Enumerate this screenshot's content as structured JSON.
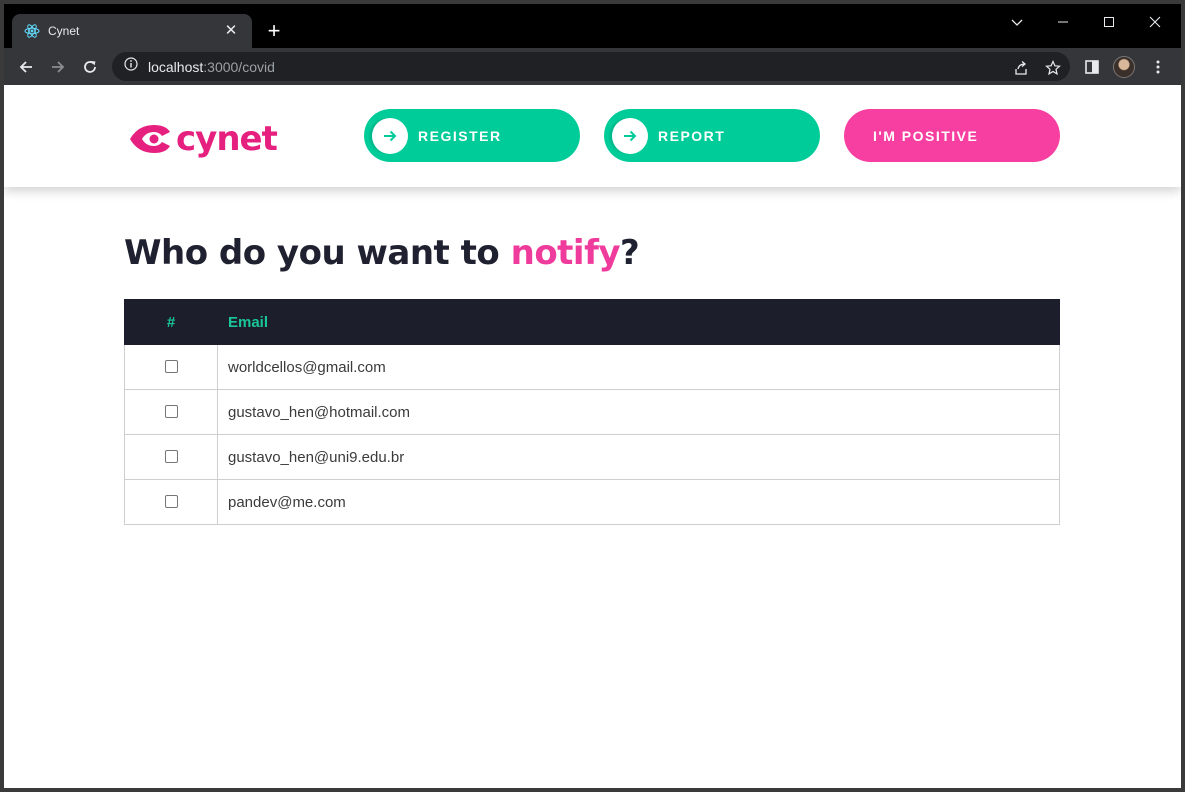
{
  "browser": {
    "tab_title": "Cynet",
    "new_tab_label": "+",
    "url_host": "localhost",
    "url_path": ":3000/covid"
  },
  "header": {
    "logo_text": "cynet",
    "buttons": {
      "register": "REGISTER",
      "report": "REPORT",
      "positive": "I'M POSITIVE"
    }
  },
  "main": {
    "title_prefix": "Who do you want to ",
    "title_accent": "notify",
    "title_suffix": "?",
    "table": {
      "columns": [
        "#",
        "Email"
      ],
      "rows": [
        {
          "email": "worldcellos@gmail.com",
          "checked": false
        },
        {
          "email": "gustavo_hen@hotmail.com",
          "checked": false
        },
        {
          "email": "gustavo_hen@uni9.edu.br",
          "checked": false
        },
        {
          "email": "pandev@me.com",
          "checked": false
        }
      ]
    }
  },
  "colors": {
    "brand_pink": "#e5207f",
    "accent_green": "#00cc99",
    "positive_pink": "#f73ea1",
    "table_header_bg": "#1c1f2b"
  }
}
